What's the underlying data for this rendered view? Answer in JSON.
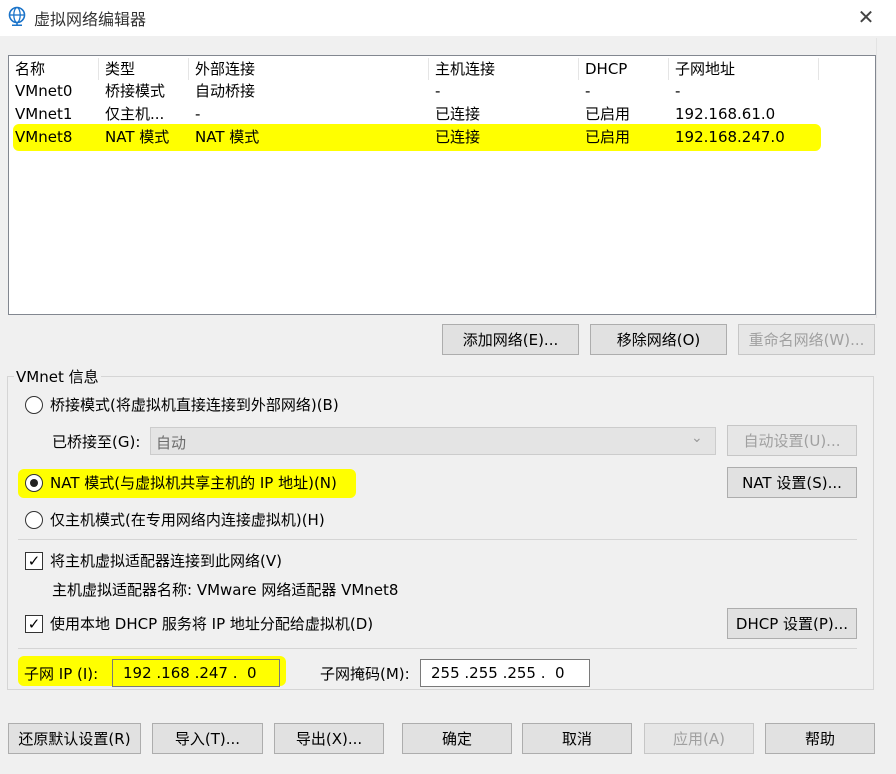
{
  "window": {
    "title": "虚拟网络编辑器",
    "icon": "globe-network-icon",
    "close_icon": "close-icon"
  },
  "table": {
    "columns": [
      "名称",
      "类型",
      "外部连接",
      "主机连接",
      "DHCP",
      "子网地址"
    ],
    "rows": [
      [
        "VMnet0",
        "桥接模式",
        "自动桥接",
        "-",
        "-",
        "-"
      ],
      [
        "VMnet1",
        "仅主机...",
        "-",
        "已连接",
        "已启用",
        "192.168.61.0"
      ],
      [
        "VMnet8",
        "NAT 模式",
        "NAT 模式",
        "已连接",
        "已启用",
        "192.168.247.0"
      ]
    ],
    "selected_row": 2
  },
  "list_buttons": {
    "add": "添加网络(E)...",
    "remove": "移除网络(O)",
    "rename": "重命名网络(W)..."
  },
  "vmnet_info": {
    "title": "VMnet 信息",
    "bridged_label": "桥接模式(将虚拟机直接连接到外部网络)(B)",
    "bridged_to_label": "已桥接至(G):",
    "bridged_to_value": "自动",
    "auto_settings": "自动设置(U)...",
    "nat_label": "NAT 模式(与虚拟机共享主机的 IP 地址)(N)",
    "nat_settings": "NAT 设置(S)...",
    "hostonly_label": "仅主机模式(在专用网络内连接虚拟机)(H)",
    "selected_mode": "nat",
    "connect_adapter_label": "将主机虚拟适配器连接到此网络(V)",
    "connect_adapter_checked": true,
    "adapter_name_text": "主机虚拟适配器名称: VMware 网络适配器 VMnet8",
    "dhcp_label": "使用本地 DHCP 服务将 IP 地址分配给虚拟机(D)",
    "dhcp_checked": true,
    "dhcp_settings": "DHCP 设置(P)...",
    "subnet_ip_label": "子网 IP (I):",
    "subnet_ip_value": "192 .168 .247 .  0",
    "subnet_mask_label": "子网掩码(M):",
    "subnet_mask_value": "255 .255 .255 .  0"
  },
  "footer_buttons": {
    "restore": "还原默认设置(R)",
    "import": "导入(T)...",
    "export": "导出(X)...",
    "ok": "确定",
    "cancel": "取消",
    "apply": "应用(A)",
    "help": "帮助"
  },
  "colors": {
    "highlight": "#ffff00",
    "background": "#f0f0f0",
    "disabled_text": "#a0a0a0"
  }
}
